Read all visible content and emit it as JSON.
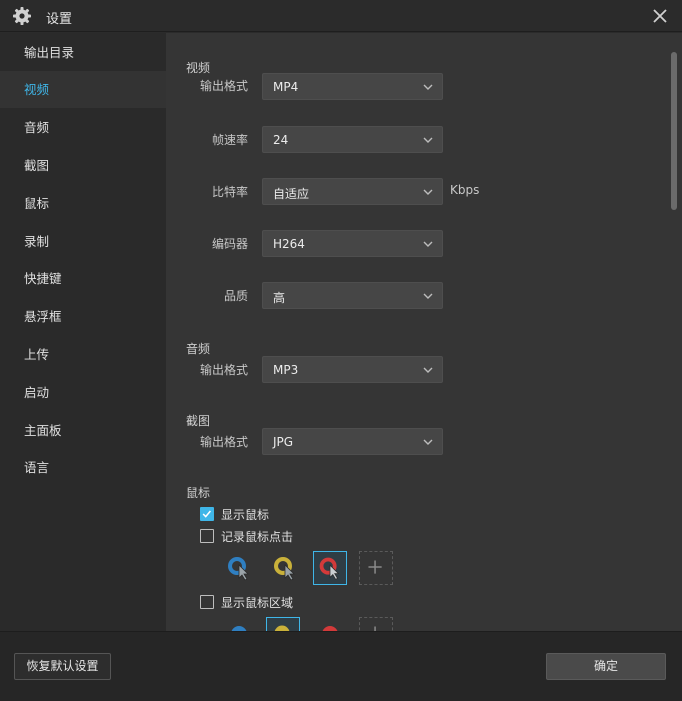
{
  "window": {
    "title": "设置",
    "icon": "gear-icon"
  },
  "sidebar": {
    "items": [
      {
        "label": "输出目录"
      },
      {
        "label": "视频",
        "active": true
      },
      {
        "label": "音频"
      },
      {
        "label": "截图"
      },
      {
        "label": "鼠标"
      },
      {
        "label": "录制"
      },
      {
        "label": "快捷键"
      },
      {
        "label": "悬浮框"
      },
      {
        "label": "上传"
      },
      {
        "label": "启动"
      },
      {
        "label": "主面板"
      },
      {
        "label": "语言"
      }
    ]
  },
  "video": {
    "section": "视频",
    "format": {
      "label": "输出格式",
      "value": "MP4"
    },
    "fps": {
      "label": "帧速率",
      "value": "24"
    },
    "bitrate": {
      "label": "比特率",
      "value": "自适应",
      "unit": "Kbps"
    },
    "encoder": {
      "label": "编码器",
      "value": "H264"
    },
    "quality": {
      "label": "品质",
      "value": "高"
    }
  },
  "audio": {
    "section": "音频",
    "format": {
      "label": "输出格式",
      "value": "MP3"
    }
  },
  "screenshot": {
    "section": "截图",
    "format": {
      "label": "输出格式",
      "value": "JPG"
    }
  },
  "mouse": {
    "section": "鼠标",
    "show_cursor": {
      "label": "显示鼠标",
      "checked": true
    },
    "record_clicks": {
      "label": "记录鼠标点击",
      "checked": false
    },
    "show_area": {
      "label": "显示鼠标区域",
      "checked": false
    },
    "click_styles": [
      {
        "icon": "blue-click-cursor-icon",
        "color": "#2f7fc1",
        "selected": false
      },
      {
        "icon": "yellow-click-cursor-icon",
        "color": "#c9b13a",
        "selected": false
      },
      {
        "icon": "red-click-cursor-icon",
        "color": "#d23a3a",
        "selected": true
      }
    ],
    "area_styles": [
      {
        "icon": "blue-area-icon",
        "color": "#2f7fc1",
        "selected": false
      },
      {
        "icon": "yellow-area-icon",
        "color": "#c9b13a",
        "selected": true
      },
      {
        "icon": "red-area-icon",
        "color": "#d23a3a",
        "selected": false
      }
    ]
  },
  "footer": {
    "reset_label": "恢复默认设置",
    "ok_label": "确定"
  },
  "colors": {
    "accent": "#3fb6e8",
    "background": "#353535",
    "sidebar": "#2a2a2a"
  }
}
